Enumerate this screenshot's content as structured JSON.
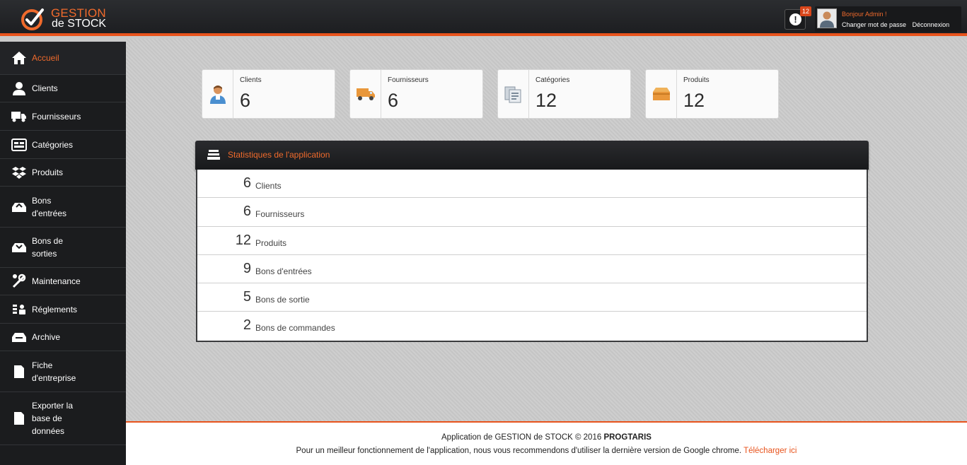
{
  "app": {
    "logo_line1": "GESTION",
    "logo_line2": "de STOCK",
    "accent_color": "#e8531c"
  },
  "header": {
    "notification_icon": "alert-icon",
    "notification_count": "12",
    "user_greeting": "Bonjour Admin !",
    "change_password": "Changer mot de passe",
    "logout": "Déconnexion"
  },
  "sidebar": {
    "items": [
      {
        "label": "Accueil",
        "icon": "home-icon",
        "active": true
      },
      {
        "label": "Clients",
        "icon": "user-icon"
      },
      {
        "label": "Fournisseurs",
        "icon": "truck-icon"
      },
      {
        "label": "Catégories",
        "icon": "categories-icon"
      },
      {
        "label": "Produits",
        "icon": "products-icon"
      },
      {
        "label": "Bons\nd'entrées",
        "icon": "inbox-in-icon"
      },
      {
        "label": "Bons de\nsorties",
        "icon": "inbox-out-icon"
      },
      {
        "label": "Maintenance",
        "icon": "wrench-icon"
      },
      {
        "label": "Réglements",
        "icon": "payments-icon"
      },
      {
        "label": "Archive",
        "icon": "archive-icon"
      },
      {
        "label": "Fiche\nd'entreprise",
        "icon": "document-icon"
      },
      {
        "label": "Exporter la\nbase de\ndonnées",
        "icon": "export-icon"
      }
    ]
  },
  "cards": [
    {
      "label": "Clients",
      "value": "6",
      "icon": "client-icon"
    },
    {
      "label": "Fournisseurs",
      "value": "6",
      "icon": "truck-icon"
    },
    {
      "label": "Catégories",
      "value": "12",
      "icon": "catalog-icon"
    },
    {
      "label": "Produits",
      "value": "12",
      "icon": "box-icon"
    }
  ],
  "stats_panel": {
    "title": "Statistiques de l'application",
    "icon": "stack-icon",
    "rows": [
      {
        "value": "6",
        "label": "Clients"
      },
      {
        "value": "6",
        "label": "Fournisseurs"
      },
      {
        "value": "12",
        "label": "Produits"
      },
      {
        "value": "9",
        "label": "Bons d'entrées"
      },
      {
        "value": "5",
        "label": "Bons de sortie"
      },
      {
        "value": "2",
        "label": "Bons de commandes"
      }
    ]
  },
  "footer": {
    "line1_prefix": "Application de GESTION de STOCK © 2016 ",
    "line1_brand": "PROGTARIS",
    "line2_text": "Pour un meilleur fonctionnement de l'application, nous vous recommendons d'utiliser la dernière version de Google chrome. ",
    "line2_link": "Télécharger ici"
  }
}
